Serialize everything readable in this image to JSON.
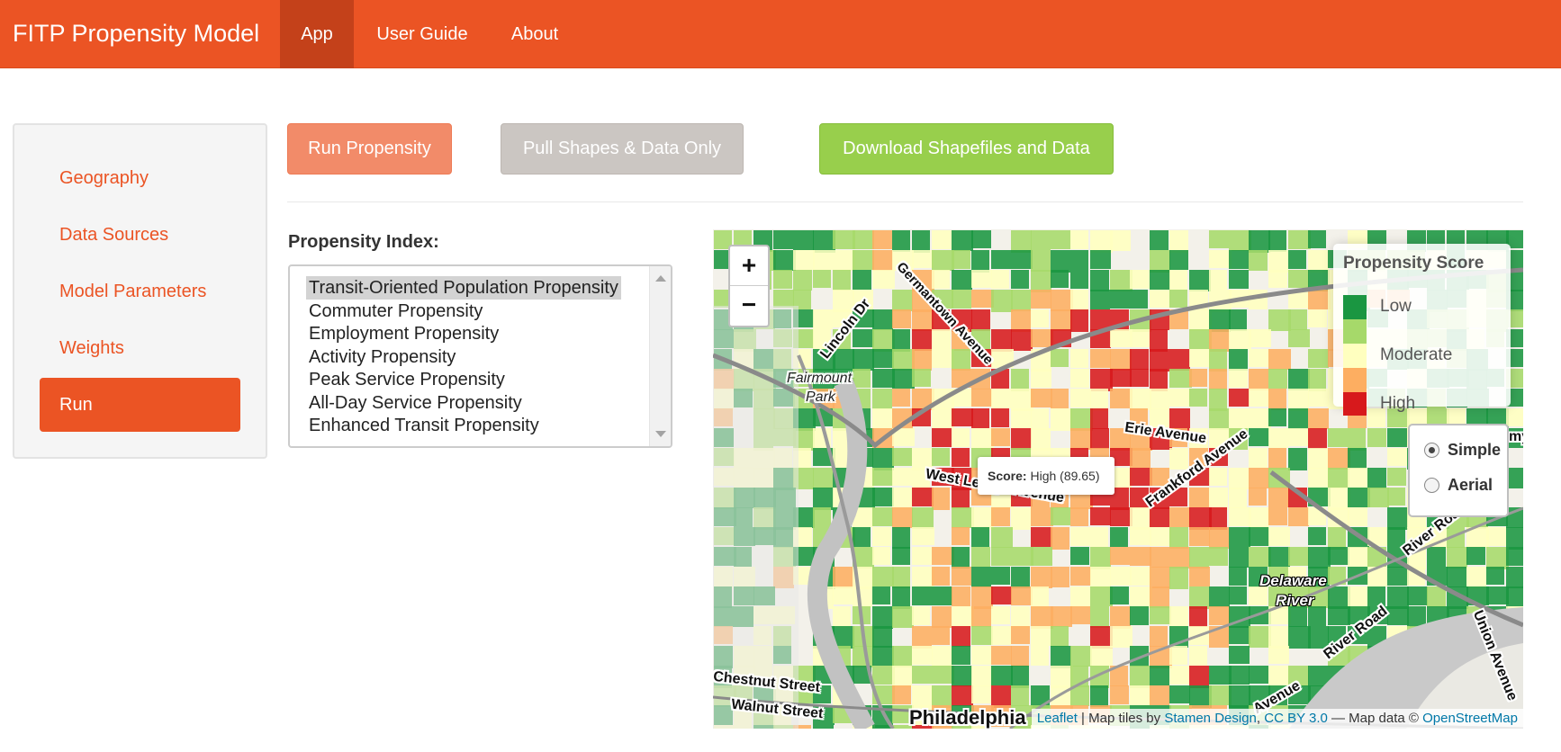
{
  "navbar": {
    "brand": "FITP Propensity Model",
    "items": [
      "App",
      "User Guide",
      "About"
    ]
  },
  "sidebar": {
    "items": [
      "Geography",
      "Data Sources",
      "Model Parameters",
      "Weights",
      "Run"
    ],
    "active": "Run"
  },
  "buttons": {
    "run": "Run Propensity",
    "pull": "Pull Shapes & Data Only",
    "download": "Download Shapefiles and Data"
  },
  "propensity_index": {
    "label": "Propensity Index:",
    "options": [
      "Transit-Oriented Population Propensity",
      "Commuter Propensity",
      "Employment Propensity",
      "Activity Propensity",
      "Peak Service Propensity",
      "All-Day Service Propensity",
      "Enhanced Transit Propensity"
    ],
    "selected": "Transit-Oriented Population Propensity"
  },
  "map": {
    "zoom_in": "+",
    "zoom_out": "−",
    "legend": {
      "title": "Propensity Score",
      "entries": [
        {
          "color": "#1a9641",
          "label": "Low"
        },
        {
          "color": "#a6d96a",
          "label": ""
        },
        {
          "color": "#ffffbf",
          "label": "Moderate"
        },
        {
          "color": "#fdae61",
          "label": ""
        },
        {
          "color": "#d7191c",
          "label": "High"
        }
      ]
    },
    "base_layers": {
      "options": [
        "Simple",
        "Aerial"
      ],
      "selected": "Simple"
    },
    "tooltip": {
      "key": "Score:",
      "value": "High (89.65)"
    },
    "labels": {
      "lincoln": "Lincoln Dr",
      "germantown": "Germantown Avenue",
      "fairmount": "Fairmount",
      "park": "Park",
      "erie": "Erie Avenue",
      "lehigh": "West Lehigh Avenue",
      "frankford": "Frankford Avenue",
      "delaware": "Delaware",
      "river": "River",
      "river_road_1": "River Road",
      "river_road_2": "River Road",
      "union": "Union Avenue",
      "chestnut": "Chestnut Street",
      "walnut": "Walnut Street",
      "philadelphia": "Philadelphia",
      "avenue_bottom": "Avenue",
      "edge": "my"
    },
    "attribution": {
      "leaflet": "Leaflet",
      "sep1": " | Map tiles by ",
      "stamen": "Stamen Design",
      "comma": ", ",
      "cc": "CC BY 3.0",
      "sep2": " — Map data © ",
      "osm": "OpenStreetMap"
    }
  }
}
